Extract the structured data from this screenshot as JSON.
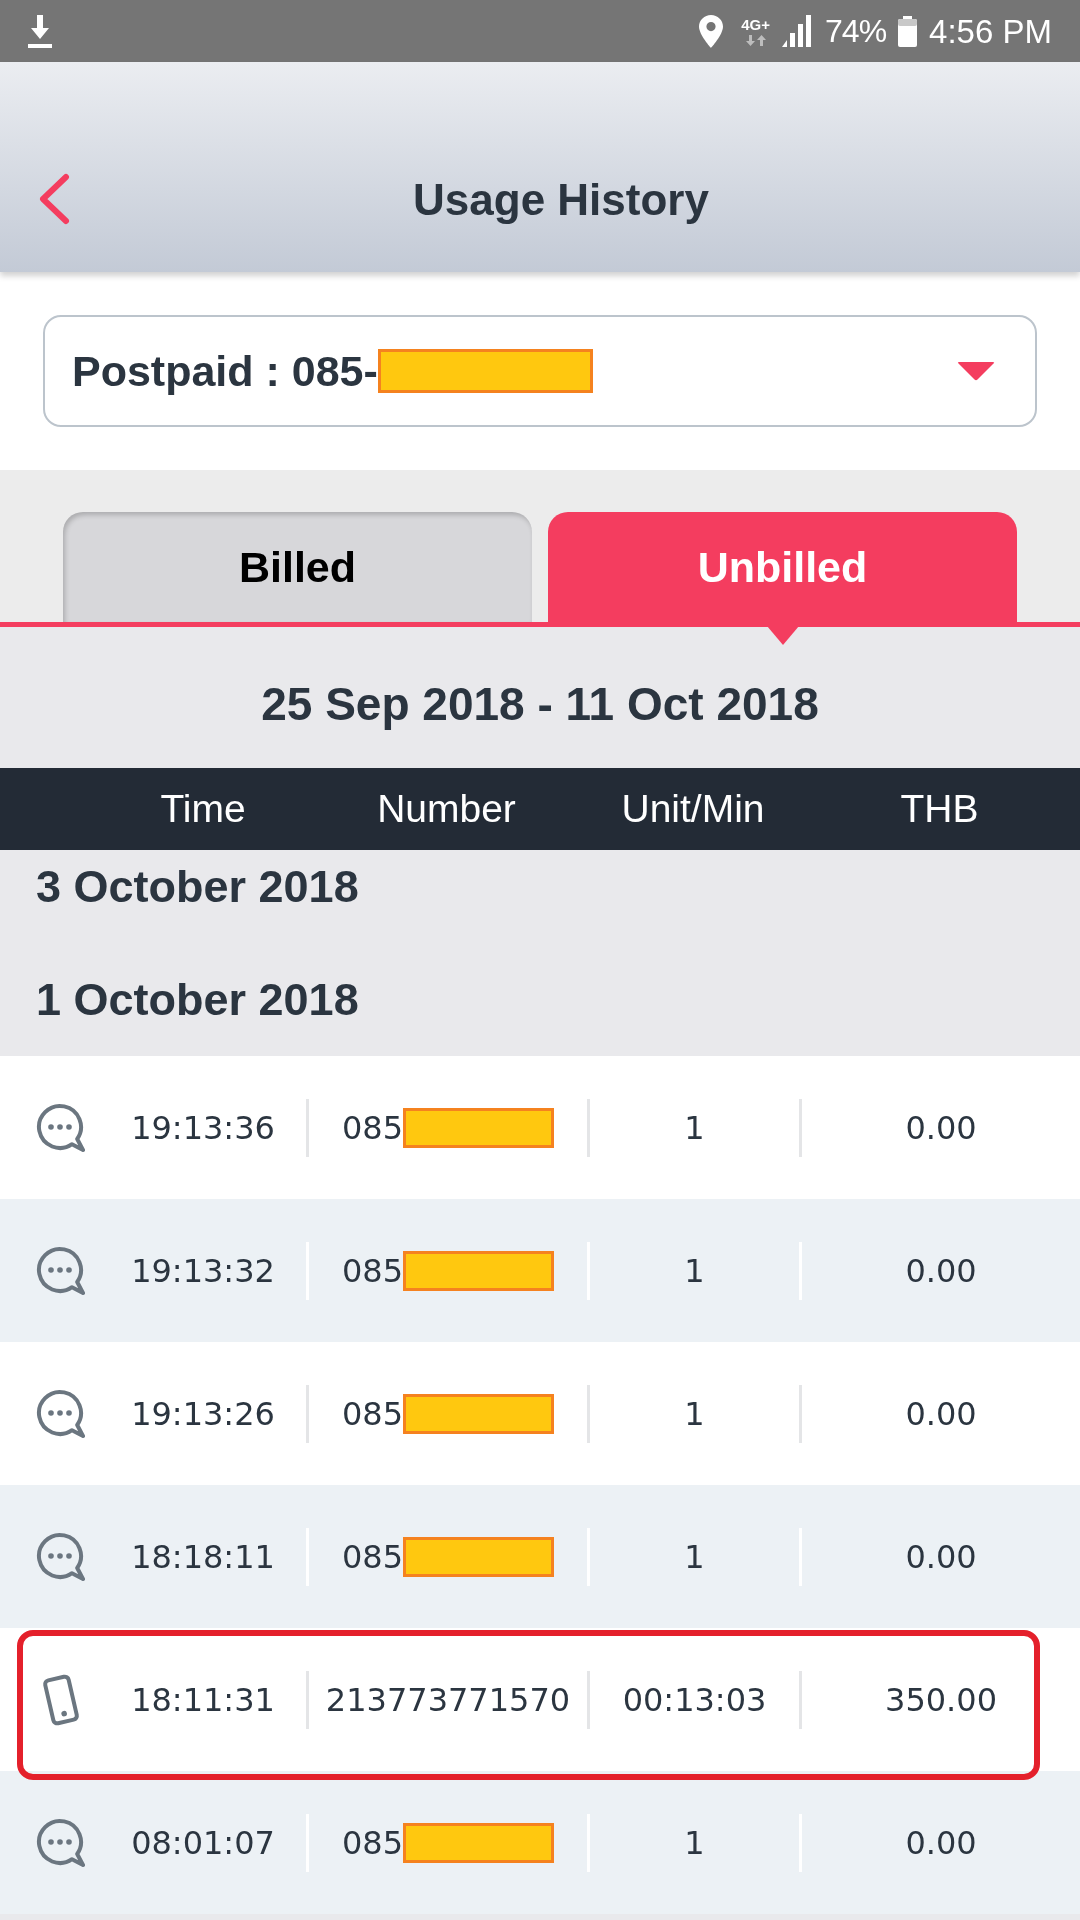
{
  "status_bar": {
    "network": "4G+",
    "battery": "74%",
    "time": "4:56 PM"
  },
  "header": {
    "title": "Usage History"
  },
  "account_select": {
    "value": "Postpaid : 085-",
    "redacted": true
  },
  "tabs": [
    {
      "label": "Billed",
      "selected": false
    },
    {
      "label": "Unbilled",
      "selected": true
    }
  ],
  "period": "25 Sep 2018 - 11 Oct 2018",
  "table": {
    "columns": [
      "Time",
      "Number",
      "Unit/Min",
      "THB"
    ],
    "groups": [
      {
        "date": "3 October 2018"
      },
      {
        "date": "1 October 2018",
        "rows": [
          {
            "kind": "message",
            "time": "19:13:36",
            "number": "085",
            "redacted": true,
            "units": "1",
            "amount": "0.00",
            "highlighted": false
          },
          {
            "kind": "message",
            "time": "19:13:32",
            "number": "085",
            "redacted": true,
            "units": "1",
            "amount": "0.00",
            "highlighted": false
          },
          {
            "kind": "message",
            "time": "19:13:26",
            "number": "085",
            "redacted": true,
            "units": "1",
            "amount": "0.00",
            "highlighted": false
          },
          {
            "kind": "message",
            "time": "18:18:11",
            "number": "085",
            "redacted": true,
            "units": "1",
            "amount": "0.00",
            "highlighted": false
          },
          {
            "kind": "call",
            "time": "18:11:31",
            "number": "213773771570",
            "redacted": false,
            "units": "00:13:03",
            "amount": "350.00",
            "highlighted": true
          },
          {
            "kind": "message",
            "time": "08:01:07",
            "number": "085",
            "redacted": true,
            "units": "1",
            "amount": "0.00",
            "highlighted": false
          }
        ]
      }
    ]
  }
}
